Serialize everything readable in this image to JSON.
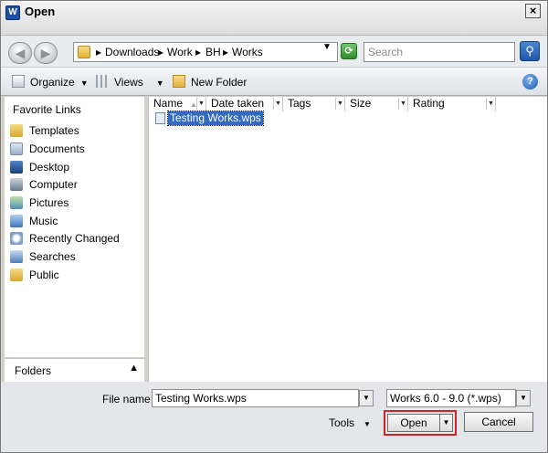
{
  "window": {
    "title": "Open",
    "close_glyph": "×"
  },
  "nav": {
    "back_glyph": "◀",
    "forward_glyph": "▶",
    "breadcrumbs": [
      "Downloads",
      "Work",
      "BH",
      "Works"
    ],
    "search_placeholder": "Search"
  },
  "toolbar": {
    "organize_label": "Organize",
    "views_label": "Views",
    "new_folder_label": "New Folder",
    "help_glyph": "?"
  },
  "sidebar": {
    "title": "Favorite Links",
    "items": [
      {
        "label": "Templates",
        "icon": "templates-folder-icon"
      },
      {
        "label": "Documents",
        "icon": "documents-icon"
      },
      {
        "label": "Desktop",
        "icon": "desktop-icon"
      },
      {
        "label": "Computer",
        "icon": "computer-icon"
      },
      {
        "label": "Pictures",
        "icon": "pictures-icon"
      },
      {
        "label": "Music",
        "icon": "music-icon"
      },
      {
        "label": "Recently Changed",
        "icon": "recently-changed-icon"
      },
      {
        "label": "Searches",
        "icon": "searches-icon"
      },
      {
        "label": "Public",
        "icon": "public-folder-icon"
      }
    ],
    "folders_label": "Folders"
  },
  "columns": [
    "Name",
    "Date taken",
    "Tags",
    "Size",
    "Rating"
  ],
  "files": [
    {
      "name": "Testing Works.wps",
      "selected": true
    }
  ],
  "footer": {
    "filename_label": "File name:",
    "filename_value": "Testing Works.wps",
    "filetype_value": "Works 6.0 - 9.0 (*.wps)",
    "tools_label": "Tools",
    "open_label": "Open",
    "cancel_label": "Cancel"
  },
  "colors": {
    "selection": "#316ac5",
    "highlight_box": "#d62424"
  }
}
